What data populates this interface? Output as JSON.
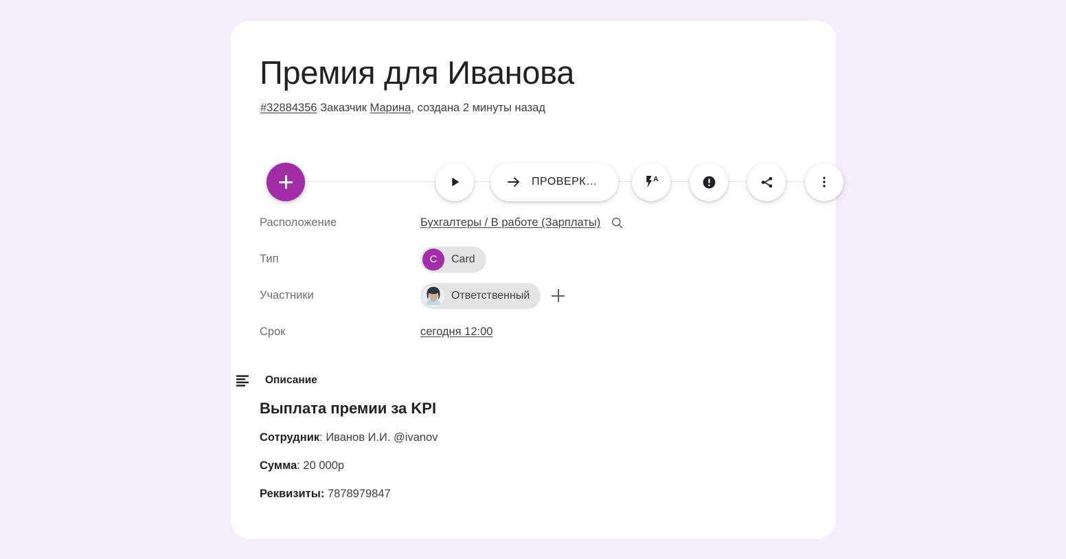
{
  "theme": {
    "page_background": "#f5edfb",
    "card_background": "#ffffff",
    "accent_purple": "#a32ca8",
    "text_primary": "#202124",
    "text_secondary": "#6e6e6e",
    "chip_background": "#e4e4e6"
  },
  "card": {
    "title": "Премия для Иванова",
    "subtitle": {
      "id": "#32884356",
      "requester_prefix": "Заказчик",
      "requester": "Марина",
      "created": ", создана 2 минуты назад"
    }
  },
  "actions": {
    "add_label": "+",
    "play_label": "play-triangle",
    "check_label": "ПРОВЕРК…",
    "flash_label": "flash-auto",
    "alert_label": "alert",
    "share_label": "share",
    "more_label": "more"
  },
  "properties": [
    {
      "label": "Расположение",
      "value": "Бухгалтеры / В работе (Зарплаты)",
      "type": "link-with-search"
    },
    {
      "label": "Тип",
      "value": "Card",
      "badge": "C",
      "type": "chip-letter"
    },
    {
      "label": "Участники",
      "value": "Ответственный",
      "type": "chip-avatar"
    },
    {
      "label": "Срок",
      "value": "сегодня 12:00",
      "type": "link"
    }
  ],
  "description": {
    "section_label": "Описание",
    "heading": "Выплата премии за KPI",
    "lines": [
      {
        "label": "Сотрудник",
        "sep": ": ",
        "value": "Иванов И.И. @ivanov"
      },
      {
        "label": "Сумма",
        "sep": ": ",
        "value": "20 000р"
      },
      {
        "label": "Реквизиты:",
        "sep": " ",
        "value": "7878979847"
      }
    ]
  }
}
